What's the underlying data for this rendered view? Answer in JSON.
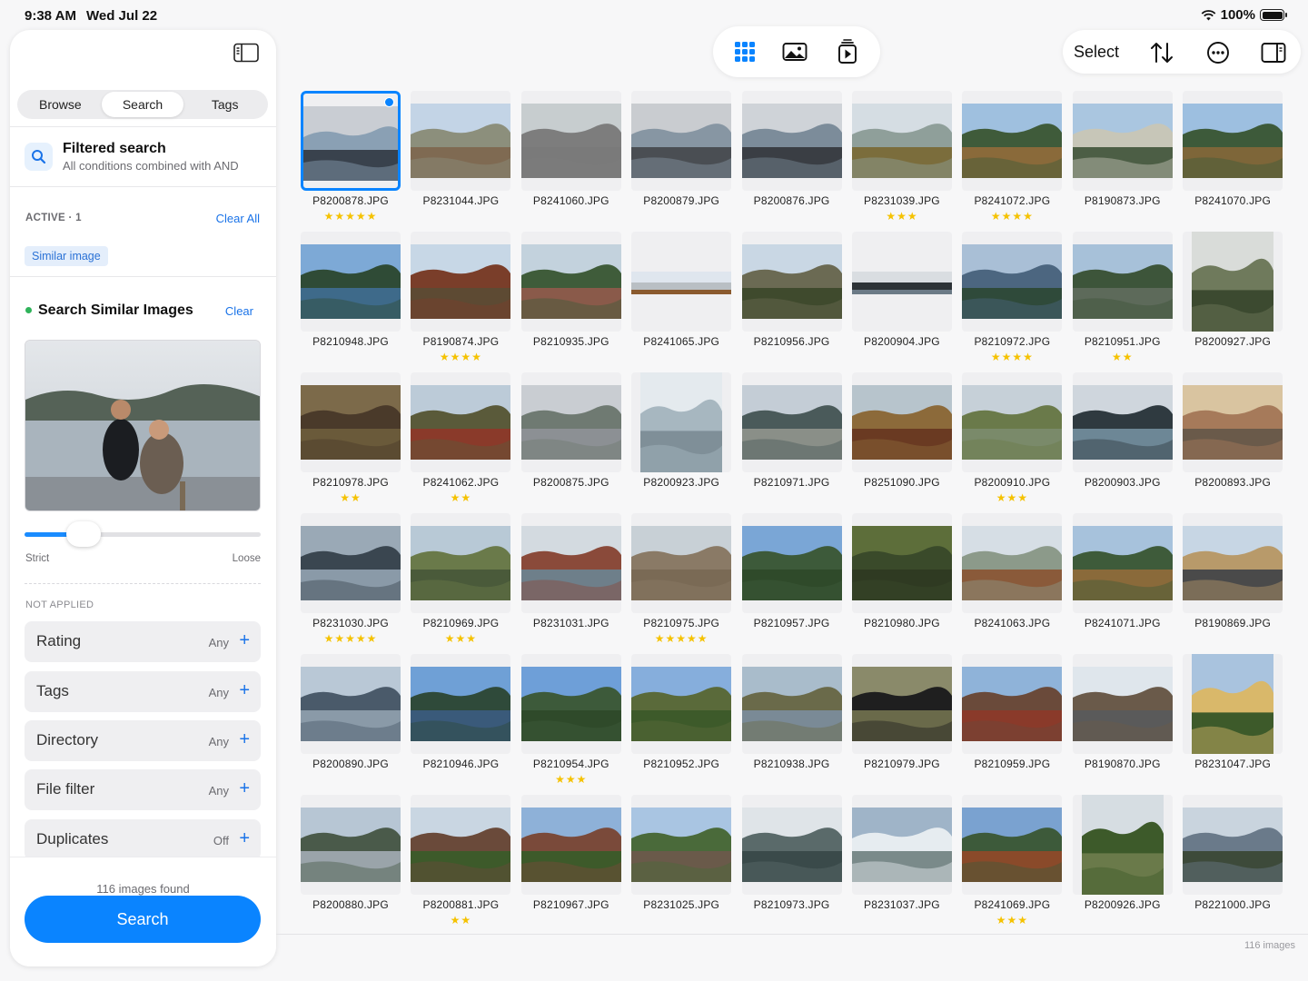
{
  "status": {
    "time": "9:38 AM",
    "date": "Wed Jul 22",
    "battery": "100%",
    "battery_level": 1.0
  },
  "sidebar": {
    "tabs": [
      "Browse",
      "Search",
      "Tags"
    ],
    "active_tab": "Search",
    "filtered_search": {
      "title": "Filtered search",
      "subtitle": "All conditions combined with AND"
    },
    "active": {
      "label": "ACTIVE · 1",
      "clear_all": "Clear All",
      "chip": "Similar image"
    },
    "similar": {
      "title": "Search Similar Images",
      "clear": "Clear",
      "strict": "Strict",
      "loose": "Loose",
      "threshold": 0.25
    },
    "not_applied": "NOT APPLIED",
    "filters": [
      {
        "label": "Rating",
        "value": "Any"
      },
      {
        "label": "Tags",
        "value": "Any"
      },
      {
        "label": "Directory",
        "value": "Any"
      },
      {
        "label": "File filter",
        "value": "Any"
      },
      {
        "label": "Duplicates",
        "value": "Off"
      }
    ],
    "plus": "+",
    "found": "116 images found",
    "search_button": "Search"
  },
  "toolbar": {
    "select": "Select"
  },
  "footer": {
    "count": "116 images"
  },
  "photos": [
    {
      "name": "P8200878.JPG",
      "stars": "★★★★★",
      "c": [
        "#c9cdd3",
        "#8aa0b4",
        "#39424d"
      ],
      "selected": true
    },
    {
      "name": "P8231044.JPG",
      "stars": "",
      "c": [
        "#c3d4e6",
        "#8c8f7c",
        "#7f6a52"
      ]
    },
    {
      "name": "P8241060.JPG",
      "stars": "",
      "c": [
        "#c7cdcf",
        "#7d7d7d",
        "#7a7a7a"
      ]
    },
    {
      "name": "P8200879.JPG",
      "stars": "",
      "c": [
        "#c9ccd0",
        "#8796a3",
        "#4a4e53"
      ]
    },
    {
      "name": "P8200876.JPG",
      "stars": "",
      "c": [
        "#cfd3d8",
        "#7c8c9a",
        "#3a3e44"
      ]
    },
    {
      "name": "P8231039.JPG",
      "stars": "★★★",
      "c": [
        "#d5dde3",
        "#8f9f9a",
        "#7b6d3c"
      ]
    },
    {
      "name": "P8241072.JPG",
      "stars": "★★★★",
      "c": [
        "#9fc0df",
        "#3f5b3a",
        "#8a6a3a"
      ]
    },
    {
      "name": "P8190873.JPG",
      "stars": "",
      "c": [
        "#aac6e0",
        "#c7c6b8",
        "#4c5e45"
      ]
    },
    {
      "name": "P8241070.JPG",
      "stars": "",
      "c": [
        "#9dbfe0",
        "#3d5a3a",
        "#7e6639"
      ]
    },
    {
      "name": "P8210948.JPG",
      "stars": "",
      "c": [
        "#7da9d6",
        "#2f4b36",
        "#3e6a8a"
      ]
    },
    {
      "name": "P8190874.JPG",
      "stars": "★★★★",
      "c": [
        "#c7d7e6",
        "#7a3e2a",
        "#5d4a33"
      ]
    },
    {
      "name": "P8210935.JPG",
      "stars": "",
      "c": [
        "#c3d2dd",
        "#3f5c3a",
        "#8a5a4a"
      ]
    },
    {
      "name": "P8241065.JPG",
      "stars": "",
      "c": [
        "#dfe6ee",
        "#b9bfc4",
        "#8a5a2e"
      ],
      "wide": true
    },
    {
      "name": "P8210956.JPG",
      "stars": "",
      "c": [
        "#c9d7e4",
        "#6b6a53",
        "#3f4a2d"
      ]
    },
    {
      "name": "P8200904.JPG",
      "stars": "",
      "c": [
        "#d9dde1",
        "#2d3337",
        "#6b7a86"
      ],
      "wide": true
    },
    {
      "name": "P8210972.JPG",
      "stars": "★★★★",
      "c": [
        "#a9bfd6",
        "#4c6680",
        "#2f4a3a"
      ]
    },
    {
      "name": "P8210951.JPG",
      "stars": "★★",
      "c": [
        "#a7c1d9",
        "#3d553a",
        "#5d6a5a"
      ]
    },
    {
      "name": "P8200927.JPG",
      "stars": "",
      "c": [
        "#d9dcd9",
        "#6f7a5c",
        "#3c4a30"
      ],
      "portrait": true
    },
    {
      "name": "P8210978.JPG",
      "stars": "★★",
      "c": [
        "#7c6a4a",
        "#4a3a2a",
        "#6a5a3a"
      ]
    },
    {
      "name": "P8241062.JPG",
      "stars": "★★",
      "c": [
        "#bccbd8",
        "#5a5a3a",
        "#8a3a2a"
      ]
    },
    {
      "name": "P8200875.JPG",
      "stars": "",
      "c": [
        "#c9cdd2",
        "#6f7a72",
        "#8c9094"
      ]
    },
    {
      "name": "P8200923.JPG",
      "stars": "",
      "c": [
        "#e4eaee",
        "#a7b7c0",
        "#7f8f98"
      ],
      "portrait": true
    },
    {
      "name": "P8210971.JPG",
      "stars": "",
      "c": [
        "#c4cdd6",
        "#4a5a5a",
        "#8a8f88"
      ]
    },
    {
      "name": "P8251090.JPG",
      "stars": "",
      "c": [
        "#b7c4cc",
        "#8c6a3a",
        "#6a3a22"
      ]
    },
    {
      "name": "P8200910.JPG",
      "stars": "★★★",
      "c": [
        "#c6d0d8",
        "#6a7a4a",
        "#7a8a6a"
      ]
    },
    {
      "name": "P8200903.JPG",
      "stars": "",
      "c": [
        "#cfd6dd",
        "#2f3a40",
        "#6d8796"
      ]
    },
    {
      "name": "P8200893.JPG",
      "stars": "",
      "c": [
        "#d9c4a0",
        "#a67a5a",
        "#6a5a4a"
      ]
    },
    {
      "name": "P8231030.JPG",
      "stars": "★★★★★",
      "c": [
        "#9aa9b6",
        "#3a4650",
        "#8a9aa8"
      ]
    },
    {
      "name": "P8210969.JPG",
      "stars": "★★★",
      "c": [
        "#b8c9d6",
        "#6a7a4a",
        "#4a5a3a"
      ]
    },
    {
      "name": "P8231031.JPG",
      "stars": "",
      "c": [
        "#d3dae0",
        "#8a4a3a",
        "#6e7f8a"
      ]
    },
    {
      "name": "P8210975.JPG",
      "stars": "★★★★★",
      "c": [
        "#c8d0d6",
        "#8a7a66",
        "#7a6a55"
      ]
    },
    {
      "name": "P8210957.JPG",
      "stars": "",
      "c": [
        "#7aa6d6",
        "#3d5a3a",
        "#2f4a2a"
      ]
    },
    {
      "name": "P8210980.JPG",
      "stars": "",
      "c": [
        "#5d6e3a",
        "#3a4a2a",
        "#2f3a22"
      ]
    },
    {
      "name": "P8241063.JPG",
      "stars": "",
      "c": [
        "#d6dee5",
        "#8c9a8a",
        "#8a5a3a"
      ]
    },
    {
      "name": "P8241071.JPG",
      "stars": "",
      "c": [
        "#a7c2dc",
        "#3e5b3a",
        "#8a6a3a"
      ]
    },
    {
      "name": "P8190869.JPG",
      "stars": "",
      "c": [
        "#c7d6e4",
        "#b89a6a",
        "#4a4a4a"
      ]
    },
    {
      "name": "P8200890.JPG",
      "stars": "",
      "c": [
        "#b9c8d6",
        "#4a5a6a",
        "#8a9aa8"
      ]
    },
    {
      "name": "P8210946.JPG",
      "stars": "",
      "c": [
        "#6fa0d6",
        "#2f4a3a",
        "#3a5a7a"
      ]
    },
    {
      "name": "P8210954.JPG",
      "stars": "★★★",
      "c": [
        "#6e9fd8",
        "#3d5a3a",
        "#2f4a2a"
      ]
    },
    {
      "name": "P8210952.JPG",
      "stars": "",
      "c": [
        "#86aedc",
        "#5a6a3a",
        "#3d5a2a"
      ]
    },
    {
      "name": "P8210938.JPG",
      "stars": "",
      "c": [
        "#a9bccb",
        "#6a6a4a",
        "#7a8a96"
      ]
    },
    {
      "name": "P8210979.JPG",
      "stars": "",
      "c": [
        "#8a8a6a",
        "#1f1f1f",
        "#6a6a4a"
      ]
    },
    {
      "name": "P8210959.JPG",
      "stars": "",
      "c": [
        "#8fb3d9",
        "#6a4a3a",
        "#8a3a2a"
      ]
    },
    {
      "name": "P8190870.JPG",
      "stars": "",
      "c": [
        "#dfe6ec",
        "#6a5a4a",
        "#5a5a5a"
      ]
    },
    {
      "name": "P8231047.JPG",
      "stars": "",
      "c": [
        "#a9c3de",
        "#d9b86a",
        "#3d5a2a"
      ],
      "portrait": true
    },
    {
      "name": "P8200880.JPG",
      "stars": "",
      "c": [
        "#b7c6d4",
        "#4a5a4a",
        "#9aa4aa"
      ]
    },
    {
      "name": "P8200881.JPG",
      "stars": "★★",
      "c": [
        "#c9d6e2",
        "#6a4a3a",
        "#3d5a2a"
      ]
    },
    {
      "name": "P8210967.JPG",
      "stars": "",
      "c": [
        "#8eb1d8",
        "#7a4a3a",
        "#3d5a2a"
      ]
    },
    {
      "name": "P8231025.JPG",
      "stars": "",
      "c": [
        "#a9c5e2",
        "#4a6a3a",
        "#6a5a4a"
      ]
    },
    {
      "name": "P8210973.JPG",
      "stars": "",
      "c": [
        "#dfe4e8",
        "#5a6a6a",
        "#3a4a4a"
      ]
    },
    {
      "name": "P8231037.JPG",
      "stars": "",
      "c": [
        "#9fb4c8",
        "#e6ecf0",
        "#7a8a8a"
      ]
    },
    {
      "name": "P8241069.JPG",
      "stars": "★★★",
      "c": [
        "#7aa2d0",
        "#3d5a3a",
        "#8a4a2a"
      ]
    },
    {
      "name": "P8200926.JPG",
      "stars": "",
      "c": [
        "#d6dde2",
        "#3d5a2a",
        "#6a7a4a"
      ],
      "portrait": true
    },
    {
      "name": "P8221000.JPG",
      "stars": "",
      "c": [
        "#c9d4de",
        "#6a7a8a",
        "#3d4a3a"
      ]
    }
  ]
}
